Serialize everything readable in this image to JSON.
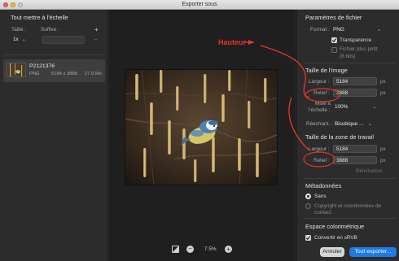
{
  "window": {
    "title": "Exporter sous"
  },
  "left_panel": {
    "heading": "Tout mettre à l'échelle",
    "size_label": "Taille :",
    "suffix_label": "Suffixe :",
    "scale_value": "1x",
    "add_symbol": "+",
    "remove_symbol": "−",
    "asset": {
      "name": "P2121376",
      "format": "PNG",
      "dimensions": "5184 x 3888",
      "filesize": "27.9 Mo"
    }
  },
  "preview": {
    "zoom": "7.5%",
    "zoom_out_symbol": "−",
    "zoom_in_symbol": "+"
  },
  "annotation": {
    "text": "Hauteur",
    "color": "#e8352a"
  },
  "file_settings": {
    "heading": "Paramètres de fichier",
    "format_label": "Format :",
    "format_value": "PNG",
    "transparency_label": "Transparence",
    "transparency_checked": true,
    "smaller_file_label": "Fichier plus petit",
    "smaller_file_sub": "(8 bits)",
    "smaller_file_checked": false
  },
  "image_size": {
    "heading": "Taille de l'image",
    "width_label": "Largeur :",
    "width_value": "5184",
    "height_label": "Relief :",
    "height_value": "3888",
    "unit": "px",
    "scale_label_1": "Mise à",
    "scale_label_2": "l'échelle :",
    "scale_value": "100%",
    "resample_label": "Rééchant. :",
    "resample_value": "Bicubique ..."
  },
  "canvas_size": {
    "heading": "Taille de la zone de travail",
    "width_label": "Largeur :",
    "width_value": "5184",
    "height_label": "Relief :",
    "height_value": "3888",
    "unit": "px",
    "reset_label": "Réinitialiser"
  },
  "metadata": {
    "heading": "Métadonnées",
    "option_none": "Sans",
    "option_copyright_1": "Copyright et coordonnées de",
    "option_copyright_2": "contact",
    "selected": "none"
  },
  "color_space": {
    "heading": "Espace colorimétrique",
    "convert_label": "Convertir en sRVB",
    "convert_checked": true
  },
  "footer": {
    "cancel_label": "Annuler",
    "export_label": "Tout exporter..."
  },
  "colors": {
    "accent": "#1d7ae8",
    "annotation": "#e8352a"
  }
}
